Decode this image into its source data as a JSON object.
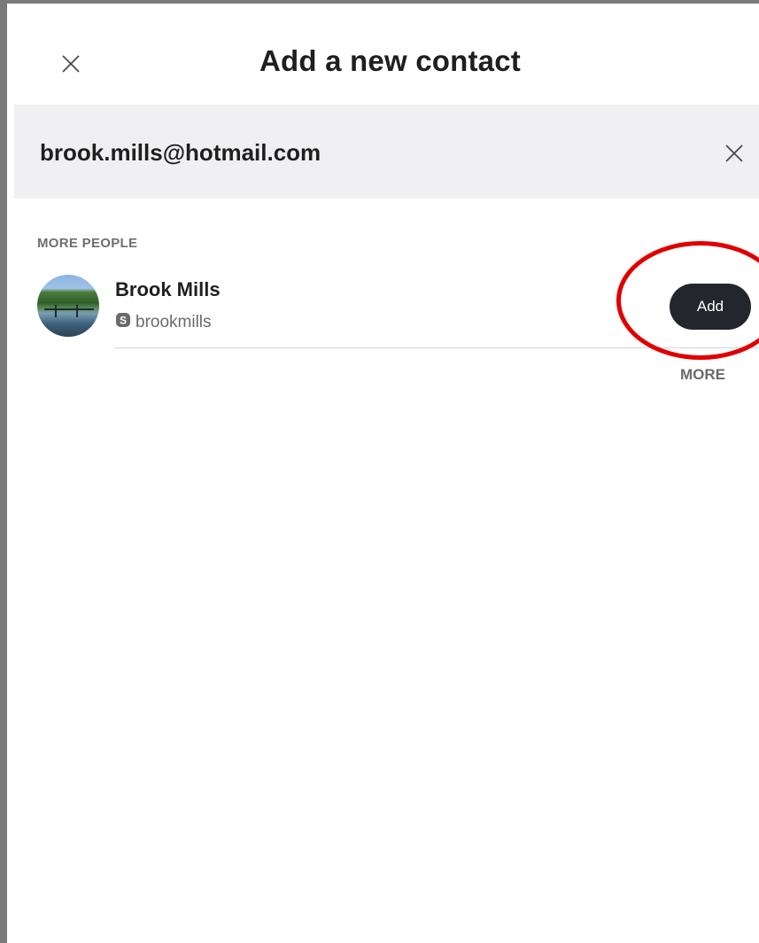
{
  "header": {
    "title": "Add a new contact"
  },
  "search": {
    "value": "brook.mills@hotmail.com"
  },
  "results": {
    "section_label": "MORE PEOPLE",
    "contacts": [
      {
        "name": "Brook Mills",
        "handle": "brookmills",
        "action_label": "Add"
      }
    ],
    "more_label": "MORE"
  },
  "colors": {
    "add_button_bg": "#24262e",
    "search_bar_bg": "#f0f0f2",
    "annotation_circle": "#e00000"
  },
  "icons": {
    "header_close": "close-icon",
    "search_clear": "close-icon",
    "handle_prefix": "skype-icon"
  }
}
